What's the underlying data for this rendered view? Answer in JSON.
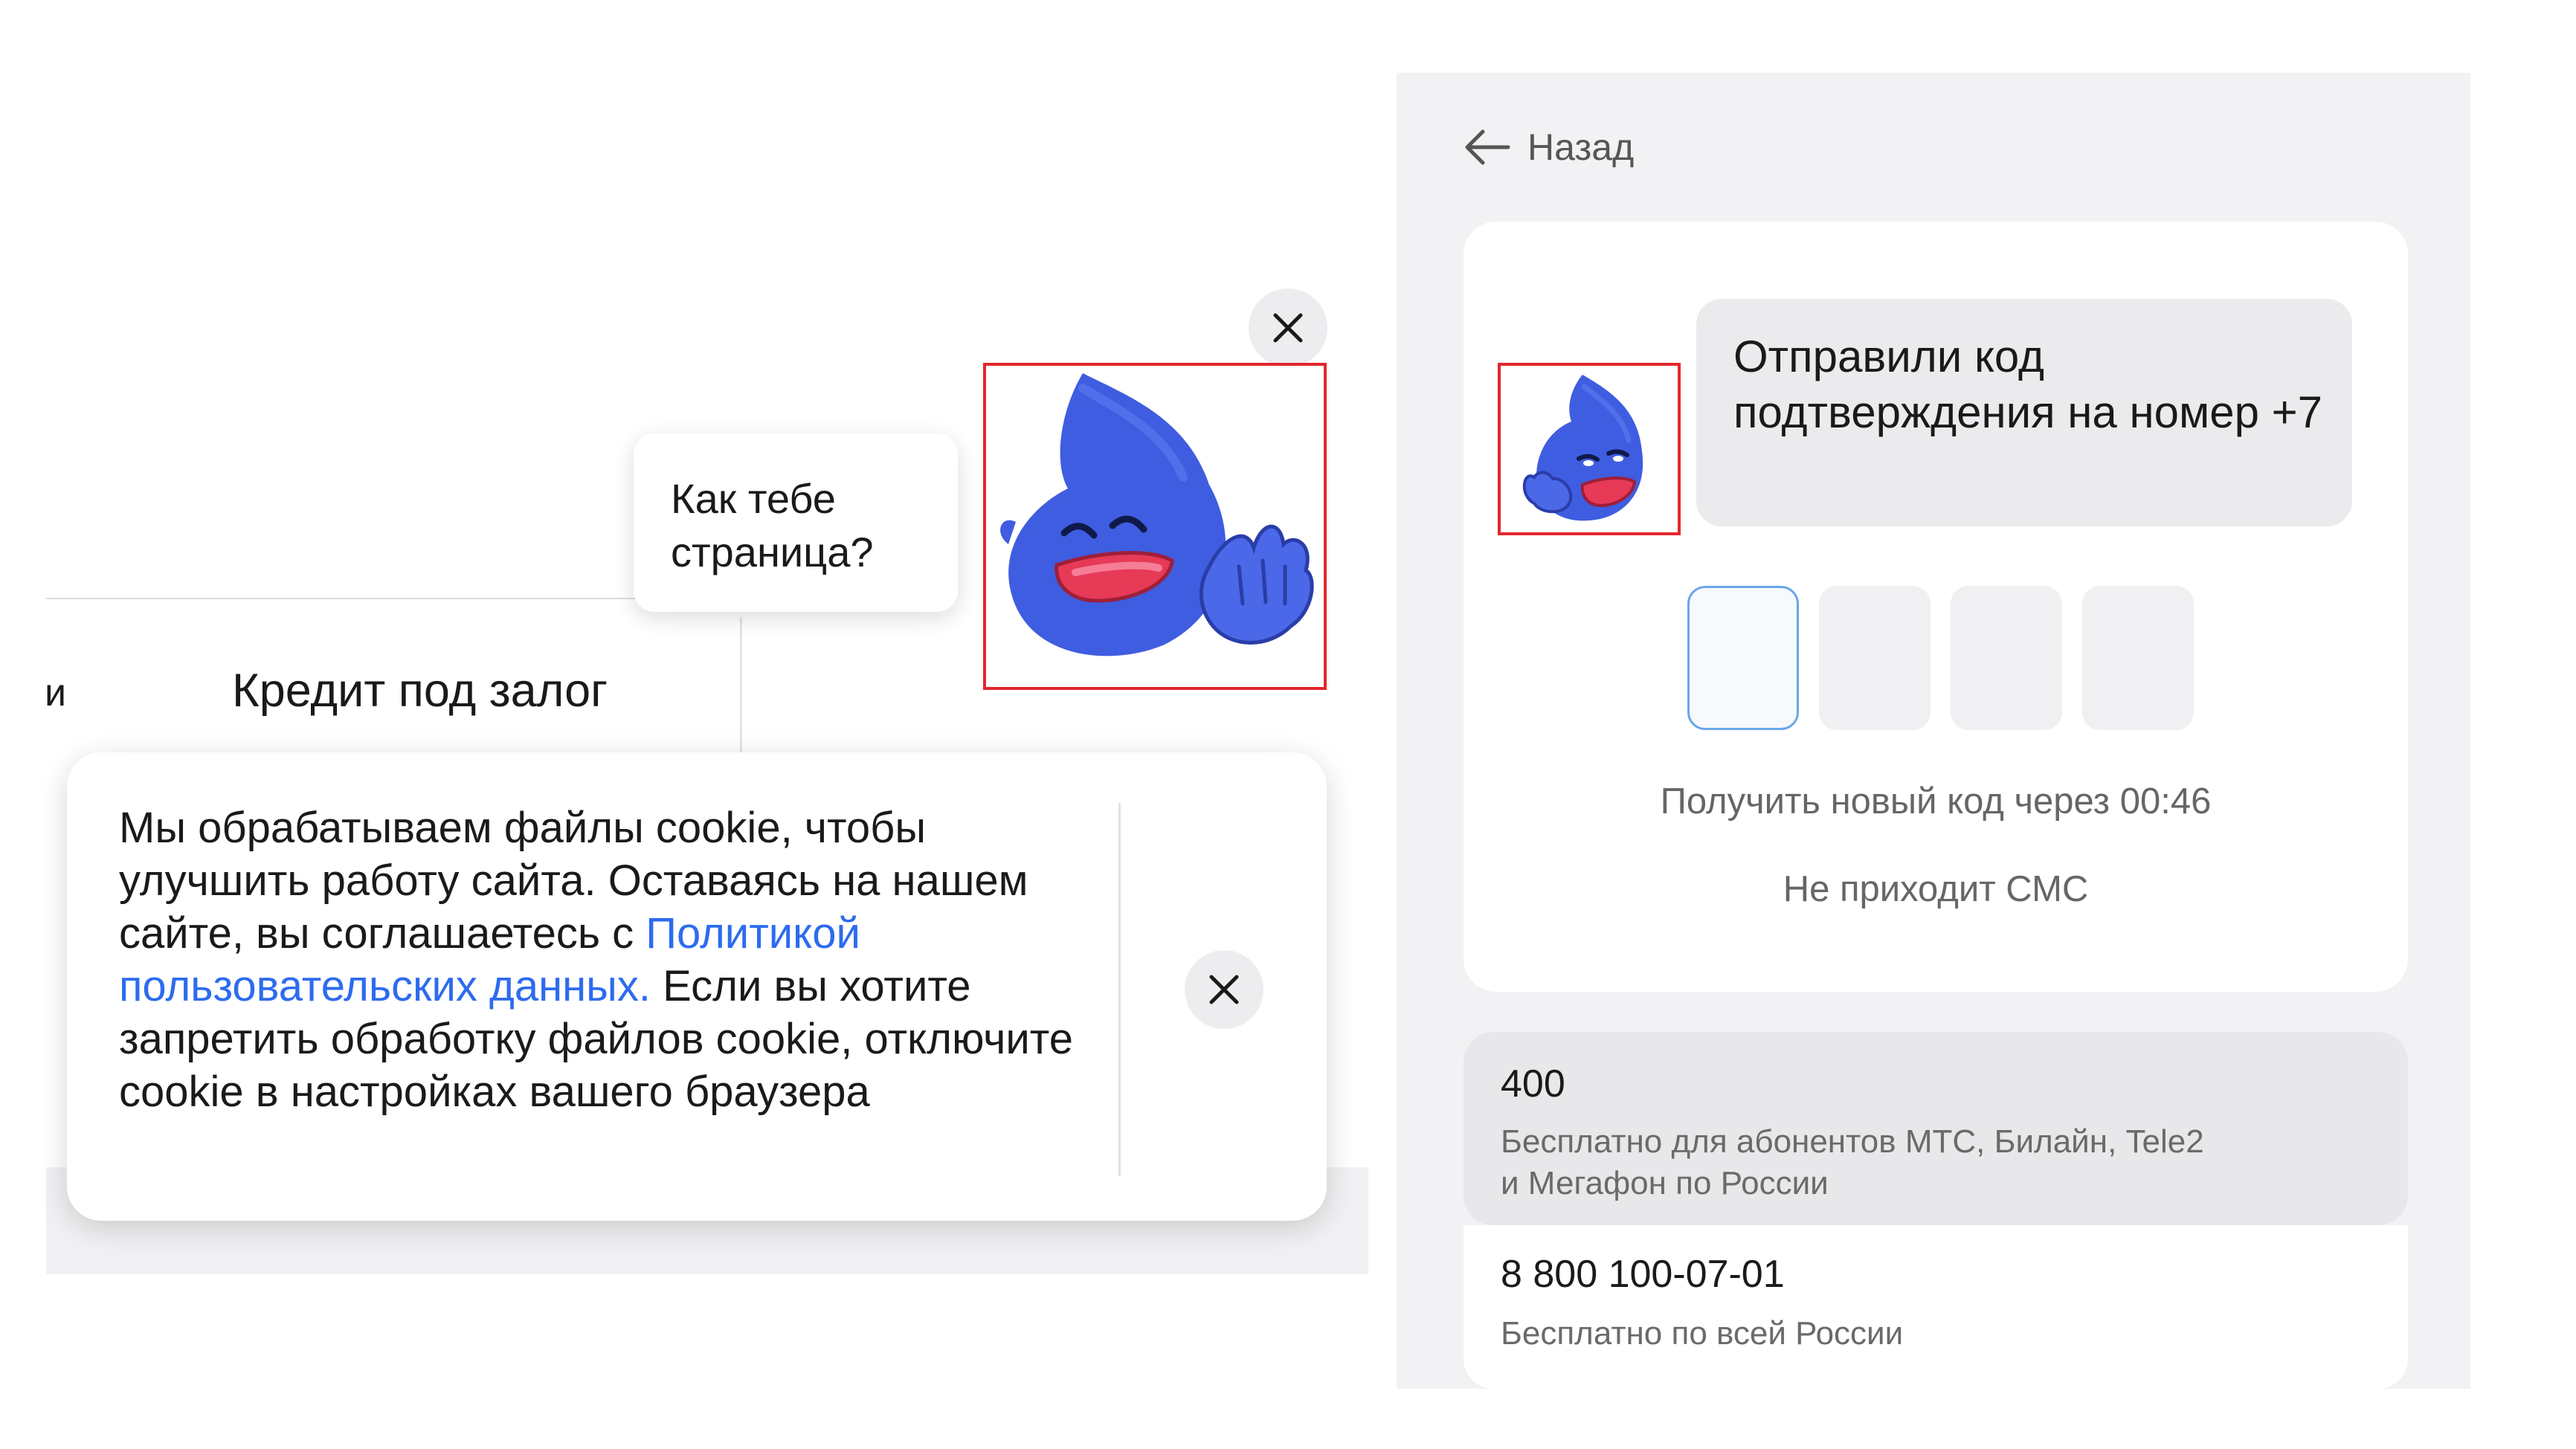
{
  "left": {
    "nav_partial": "и",
    "nav_item": "Кредит под залог",
    "mascot_bubble": "Как тебе\nстраница?",
    "cookie": {
      "text_before": "Мы обрабатываем файлы cookie, чтобы улучшить работу сайта. Оставаясь на нашем сайте, вы соглашаетесь с ",
      "link": "Политикой пользовательских данных.",
      "text_after": " Если вы хотите запретить обработку файлов cookie, отключите cookie в настройках вашего браузера"
    },
    "icons": {
      "close": "close-icon",
      "mascot": "waving-mascot-icon"
    }
  },
  "right": {
    "back_label": "Назад",
    "otp_message": "Отправили код подтверждения на номер +7",
    "otp_boxes": [
      "",
      "",
      "",
      ""
    ],
    "resend": "Получить новый код через 00:46",
    "no_sms": "Не приходит СМС",
    "contacts": [
      {
        "number": "400",
        "desc": "Бесплатно для абонентов МТС, Билайн, Tele2\nи Мегафон по России"
      },
      {
        "number": "8 800 100-07-01",
        "desc": "Бесплатно по всей России"
      }
    ],
    "icons": {
      "back": "arrow-left-icon",
      "mascot": "thinking-mascot-icon"
    }
  },
  "colors": {
    "mascot_blue": "#3f5de0",
    "link_blue": "#2d6bef",
    "highlight_red": "#e3262d",
    "otp_focus": "#6aa6e8"
  }
}
